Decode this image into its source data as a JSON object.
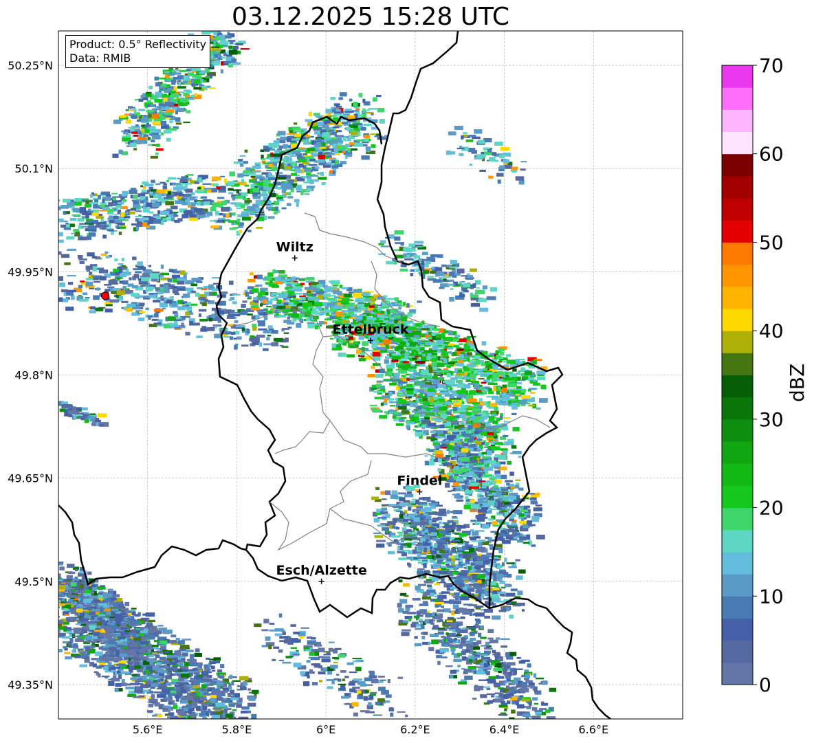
{
  "title": "03.12.2025 15:28 UTC",
  "legend": {
    "product": "Product: 0.5° Reflectivity",
    "data": "Data: RMIB"
  },
  "map": {
    "lon_range": [
      5.4,
      6.8
    ],
    "lat_range": [
      49.3,
      50.3
    ],
    "lon_ticks": [
      {
        "value": 5.6,
        "label": "5.6°E"
      },
      {
        "value": 5.8,
        "label": "5.8°E"
      },
      {
        "value": 6.0,
        "label": "6°E"
      },
      {
        "value": 6.2,
        "label": "6.2°E"
      },
      {
        "value": 6.4,
        "label": "6.4°E"
      },
      {
        "value": 6.6,
        "label": "6.6°E"
      }
    ],
    "lat_ticks": [
      {
        "value": 49.35,
        "label": "49.35°N"
      },
      {
        "value": 49.5,
        "label": "49.5°N"
      },
      {
        "value": 49.65,
        "label": "49.65°N"
      },
      {
        "value": 49.8,
        "label": "49.8°N"
      },
      {
        "value": 49.95,
        "label": "49.95°N"
      },
      {
        "value": 50.1,
        "label": "50.1°N"
      },
      {
        "value": 50.25,
        "label": "50.25°N"
      }
    ],
    "cities": [
      {
        "name": "Wiltz",
        "lon": 5.93,
        "lat": 49.97
      },
      {
        "name": "Ettelbruck",
        "lon": 6.1,
        "lat": 49.85
      },
      {
        "name": "Findel",
        "lon": 6.21,
        "lat": 49.63
      },
      {
        "name": "Esch/Alzette",
        "lon": 5.99,
        "lat": 49.5
      }
    ],
    "radar_site": {
      "lon": 5.505,
      "lat": 49.915,
      "color": "#ff0000"
    },
    "border_color": "#000000",
    "canton_color": "#808080"
  },
  "colorbar": {
    "label": "dBZ",
    "min": 0,
    "max": 70,
    "ticks": [
      0,
      10,
      20,
      30,
      40,
      50,
      60,
      70
    ],
    "colors": [
      "#6476a8",
      "#5569a0",
      "#4460a6",
      "#4a7ab4",
      "#5a9ac6",
      "#64bcdc",
      "#5ed6c6",
      "#3ed66a",
      "#14c81e",
      "#12b814",
      "#10a612",
      "#0e8e0e",
      "#0a760a",
      "#065e06",
      "#467612",
      "#aeb006",
      "#ffd800",
      "#ffb400",
      "#ff9600",
      "#ff7800",
      "#e40000",
      "#c00000",
      "#a20000",
      "#7c0000",
      "#ffe4ff",
      "#ffb4ff",
      "#ff6ef8",
      "#ea38ee"
    ]
  }
}
